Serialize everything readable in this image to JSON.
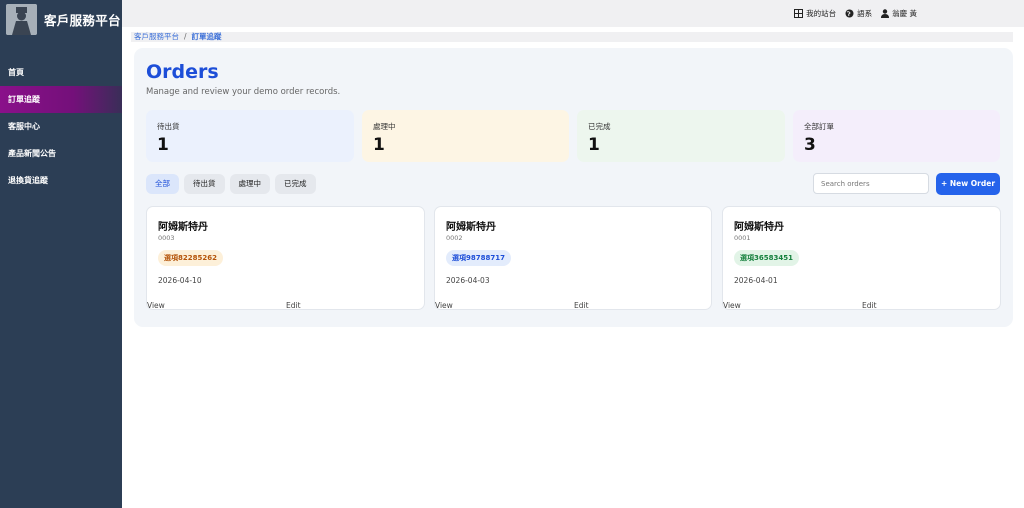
{
  "app": {
    "brand": "客戶服務平台"
  },
  "sidebar": {
    "items": [
      {
        "label": "首頁"
      },
      {
        "label": "訂單追蹤"
      },
      {
        "label": "客服中心"
      },
      {
        "label": "產品新聞公告"
      },
      {
        "label": "退換貨追蹤"
      }
    ],
    "active_index": 1
  },
  "topbar": {
    "my_site": "我的站台",
    "language": "語系",
    "user": "翁慶 黃"
  },
  "breadcrumb": {
    "root": "客戶服務平台",
    "separator": "/",
    "current": "訂單追蹤"
  },
  "main": {
    "title": "Orders",
    "subtitle": "Manage and review your demo order records."
  },
  "stats": [
    {
      "label": "待出貨",
      "value": "1",
      "bg": "#ebf1fd"
    },
    {
      "label": "處理中",
      "value": "1",
      "bg": "#fdf5e4"
    },
    {
      "label": "已完成",
      "value": "1",
      "bg": "#edf6ee"
    },
    {
      "label": "全部訂單",
      "value": "3",
      "bg": "#f4eefb"
    }
  ],
  "filters": [
    {
      "label": "全部",
      "active": true
    },
    {
      "label": "待出貨"
    },
    {
      "label": "處理中"
    },
    {
      "label": "已完成"
    }
  ],
  "search": {
    "placeholder": "Search orders",
    "value": ""
  },
  "new_order_label": "+ New Order",
  "orders": [
    {
      "name": "阿姆斯特丹",
      "id": "0003",
      "tag": "選項82285262",
      "tag_bg": "#fdf0d9",
      "tag_color": "#b45309",
      "date": "2026-04-10",
      "view": "View",
      "edit": "Edit"
    },
    {
      "name": "阿姆斯特丹",
      "id": "0002",
      "tag": "選項98788717",
      "tag_bg": "#e3ecfc",
      "tag_color": "#1d4ed8",
      "date": "2026-04-03",
      "view": "View",
      "edit": "Edit"
    },
    {
      "name": "阿姆斯特丹",
      "id": "0001",
      "tag": "選項36583451",
      "tag_bg": "#e2f4e7",
      "tag_color": "#15803d",
      "date": "2026-04-01",
      "view": "View",
      "edit": "Edit"
    }
  ]
}
